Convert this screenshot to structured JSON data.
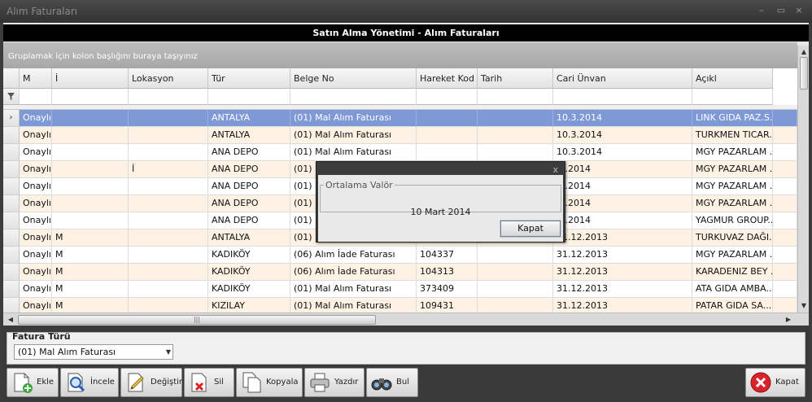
{
  "window": {
    "title": "Alım Faturaları",
    "minimize": "–",
    "maximize": "▭",
    "close": "×"
  },
  "header": {
    "title": "Satın Alma Yönetimi - Alım Faturaları"
  },
  "group_hint": "Gruplamak için kolon başlığını buraya taşıyınız",
  "grid": {
    "columns": [
      "",
      "M",
      "İ",
      "Lokasyon",
      "Tür",
      "Belge No",
      "Hareket Kod",
      "Tarih",
      "Cari Ünvan",
      "Açıkl"
    ],
    "sort_indicator": "▼",
    "filter_icon": "funnel-icon",
    "rows": [
      [
        "Onaylı",
        "",
        "",
        "ANTALYA",
        "(01) Mal Alım Faturası",
        "",
        "",
        "10.3.2014",
        "LINK GIDA PAZ.S..."
      ],
      [
        "Onaylı",
        "",
        "",
        "ANTALYA",
        "(01) Mal Alım Faturası",
        "",
        "",
        "10.3.2014",
        "TURKMEN TICAR..."
      ],
      [
        "Onaylı",
        "",
        "",
        "ANA DEPO",
        "(01) Mal Alım Faturası",
        "",
        "",
        "10.3.2014",
        "MGY PAZARLAM ..."
      ],
      [
        "Onaylı",
        "",
        "İ",
        "ANA DEPO",
        "(01) M",
        "",
        "",
        ".3.2014",
        "MGY PAZARLAM ..."
      ],
      [
        "Onaylı",
        "",
        "",
        "ANA DEPO",
        "(01) M",
        "",
        "",
        ".3.2014",
        "MGY PAZARLAM ..."
      ],
      [
        "Onaylı",
        "",
        "",
        "ANA DEPO",
        "(01) M",
        "",
        "",
        ".3.2014",
        "MGY PAZARLAM ..."
      ],
      [
        "Onaylı",
        "",
        "",
        "ANA DEPO",
        "(01) M",
        "",
        "",
        ".3.2014",
        "YAGMUR GROUP..."
      ],
      [
        "Onaylı",
        "M",
        "",
        "ANTALYA",
        "(01) M",
        "",
        "",
        "31.12.2013",
        "TURKUVAZ DAĞI..."
      ],
      [
        "Onaylı",
        "M",
        "",
        "KADIKÖY",
        "(06) Alım İade Faturası",
        "104337",
        "",
        "31.12.2013",
        "MGY PAZARLAM ..."
      ],
      [
        "Onaylı",
        "M",
        "",
        "KADIKÖY",
        "(06) Alım İade Faturası",
        "104313",
        "",
        "31.12.2013",
        "KARADENIZ BEY ..."
      ],
      [
        "Onaylı",
        "M",
        "",
        "KADIKÖY",
        "(01) Mal Alım Faturası",
        "373409",
        "",
        "31.12.2013",
        "ATA GIDA AMBA..."
      ],
      [
        "Onaylı",
        "M",
        "",
        "KIZILAY",
        "(01) Mal Alım Faturası",
        "109431",
        "",
        "31.12.2013",
        "PATAR GIDA SA..."
      ]
    ],
    "selected_row_marker": "›"
  },
  "filter_panel": {
    "label": "Fatura Türü",
    "selected": "(01) Mal Alım Faturası"
  },
  "toolbar": {
    "buttons": [
      {
        "label": "Ekle",
        "icon": "add-document-icon"
      },
      {
        "label": "İncele",
        "icon": "magnifier-document-icon"
      },
      {
        "label": "Değiştir",
        "icon": "edit-pencil-icon"
      },
      {
        "label": "Sil",
        "icon": "delete-document-icon"
      },
      {
        "label": "Kopyala",
        "icon": "copy-icon"
      },
      {
        "label": "Yazdır",
        "icon": "printer-icon"
      },
      {
        "label": "Bul",
        "icon": "binoculars-icon"
      }
    ],
    "close_label": "Kapat"
  },
  "dialog": {
    "close": "x",
    "group_label": "Ortalama Valör",
    "value": "10 Mart 2014",
    "button": "Kapat"
  }
}
